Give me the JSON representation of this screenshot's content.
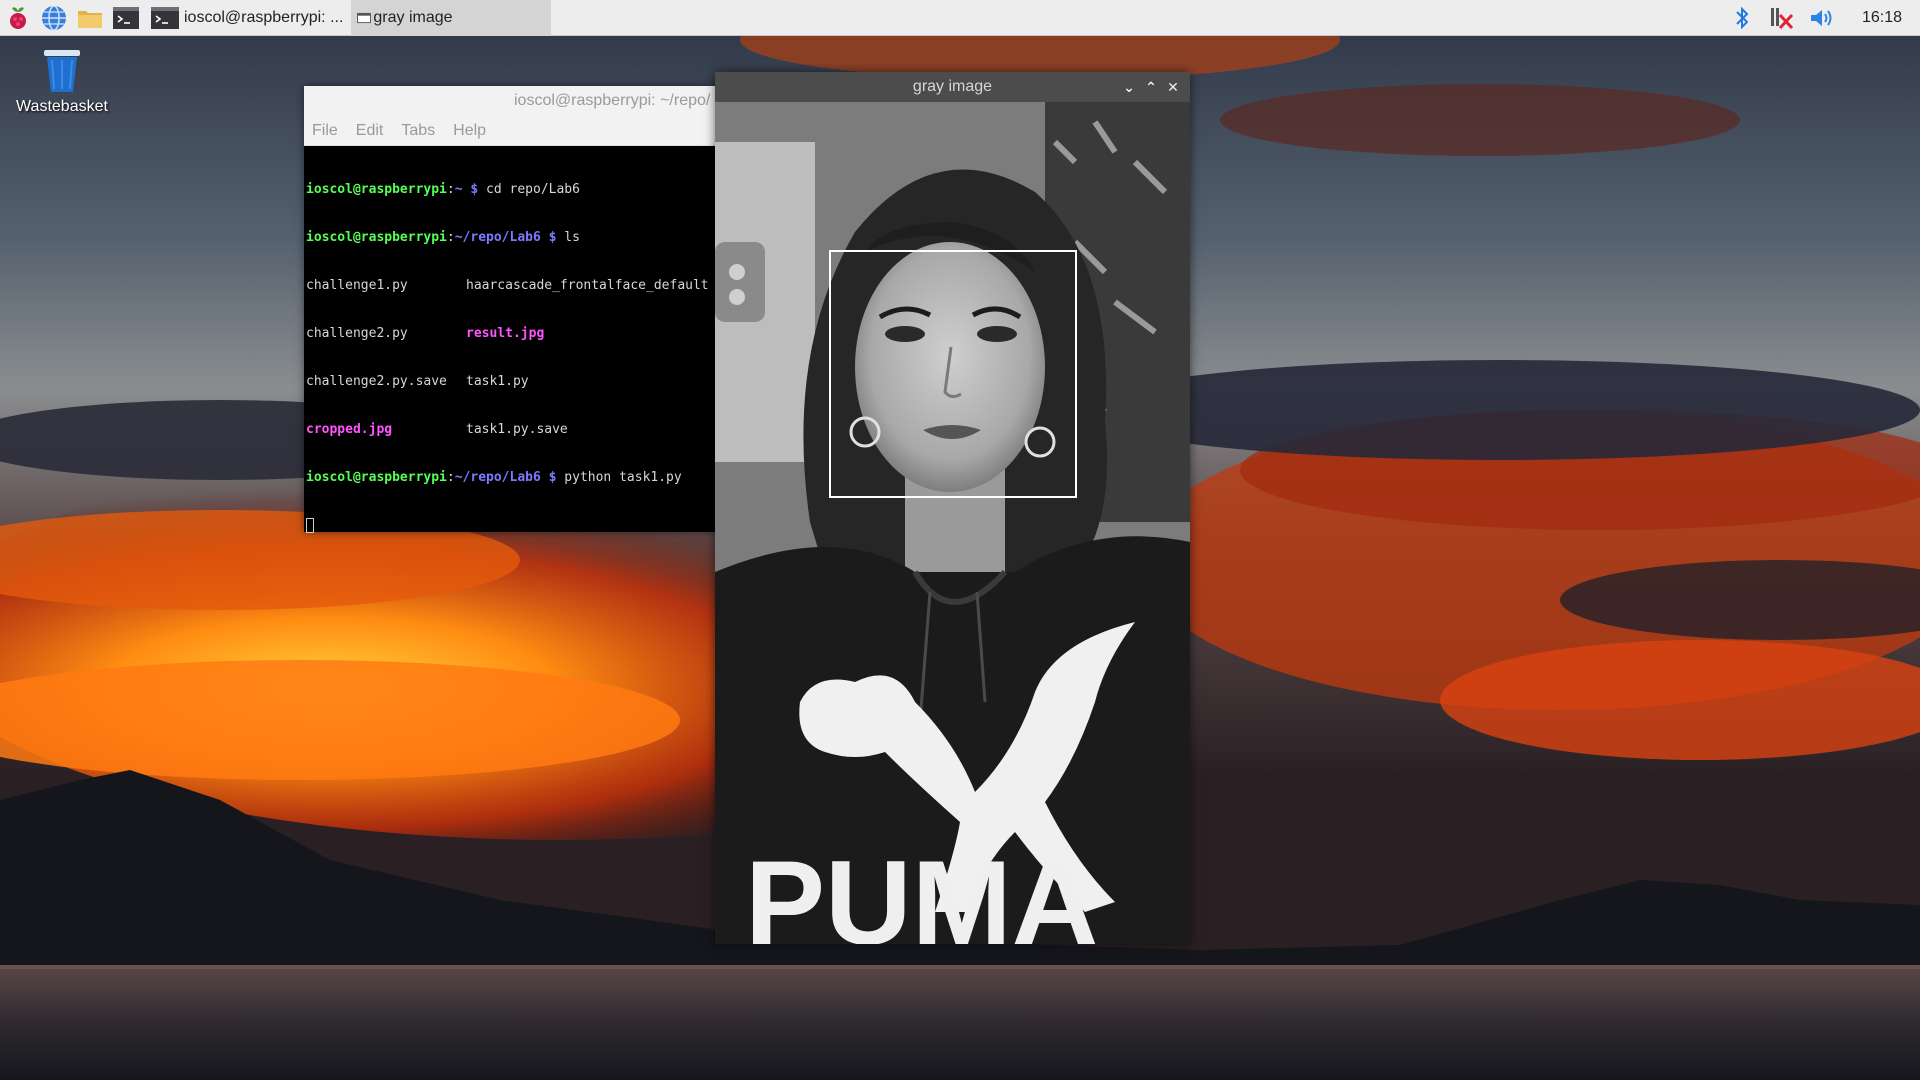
{
  "taskbar": {
    "launchers": [
      {
        "icon": "raspberry-menu-icon"
      },
      {
        "icon": "web-browser-icon"
      },
      {
        "icon": "file-manager-icon"
      },
      {
        "icon": "terminal-icon"
      }
    ],
    "tasks": [
      {
        "label": "ioscol@raspberrypi: ...",
        "icon": "terminal-icon",
        "active": false
      },
      {
        "label": "gray image",
        "icon": "window-icon",
        "active": true
      }
    ],
    "tray": [
      {
        "icon": "bluetooth-icon"
      },
      {
        "icon": "network-disconnected-icon"
      },
      {
        "icon": "volume-icon"
      }
    ],
    "clock": "16:18"
  },
  "desktop": {
    "wastebasket_label": "Wastebasket"
  },
  "terminal": {
    "title": "ioscol@raspberrypi: ~/repo/",
    "menu": [
      "File",
      "Edit",
      "Tabs",
      "Help"
    ],
    "lines": [
      {
        "user": "ioscol@raspberrypi",
        "path": "~",
        "cmd": "cd repo/Lab6"
      },
      {
        "user": "ioscol@raspberrypi",
        "path": "~/repo/Lab6",
        "cmd": "ls"
      },
      {
        "col1": "challenge1.py",
        "col1_img": false,
        "col2": "haarcascade_frontalface_default",
        "col2_img": false
      },
      {
        "col1": "challenge2.py",
        "col1_img": false,
        "col2": "result.jpg",
        "col2_img": true
      },
      {
        "col1": "challenge2.py.save",
        "col1_img": false,
        "col2": "task1.py",
        "col2_img": false
      },
      {
        "col1": "cropped.jpg",
        "col1_img": true,
        "col2": "task1.py.save",
        "col2_img": false
      },
      {
        "user": "ioscol@raspberrypi",
        "path": "~/repo/Lab6",
        "cmd": "python task1.py"
      }
    ]
  },
  "image_window": {
    "title": "gray image",
    "controls": [
      "minimize-icon",
      "maximize-icon",
      "close-icon"
    ],
    "image_text": "PUMA"
  },
  "colors": {
    "prompt_user": "#55ff55",
    "prompt_path": "#7b7bff",
    "image_file": "#ff55ff",
    "taskbar_bg": "#ededed"
  }
}
